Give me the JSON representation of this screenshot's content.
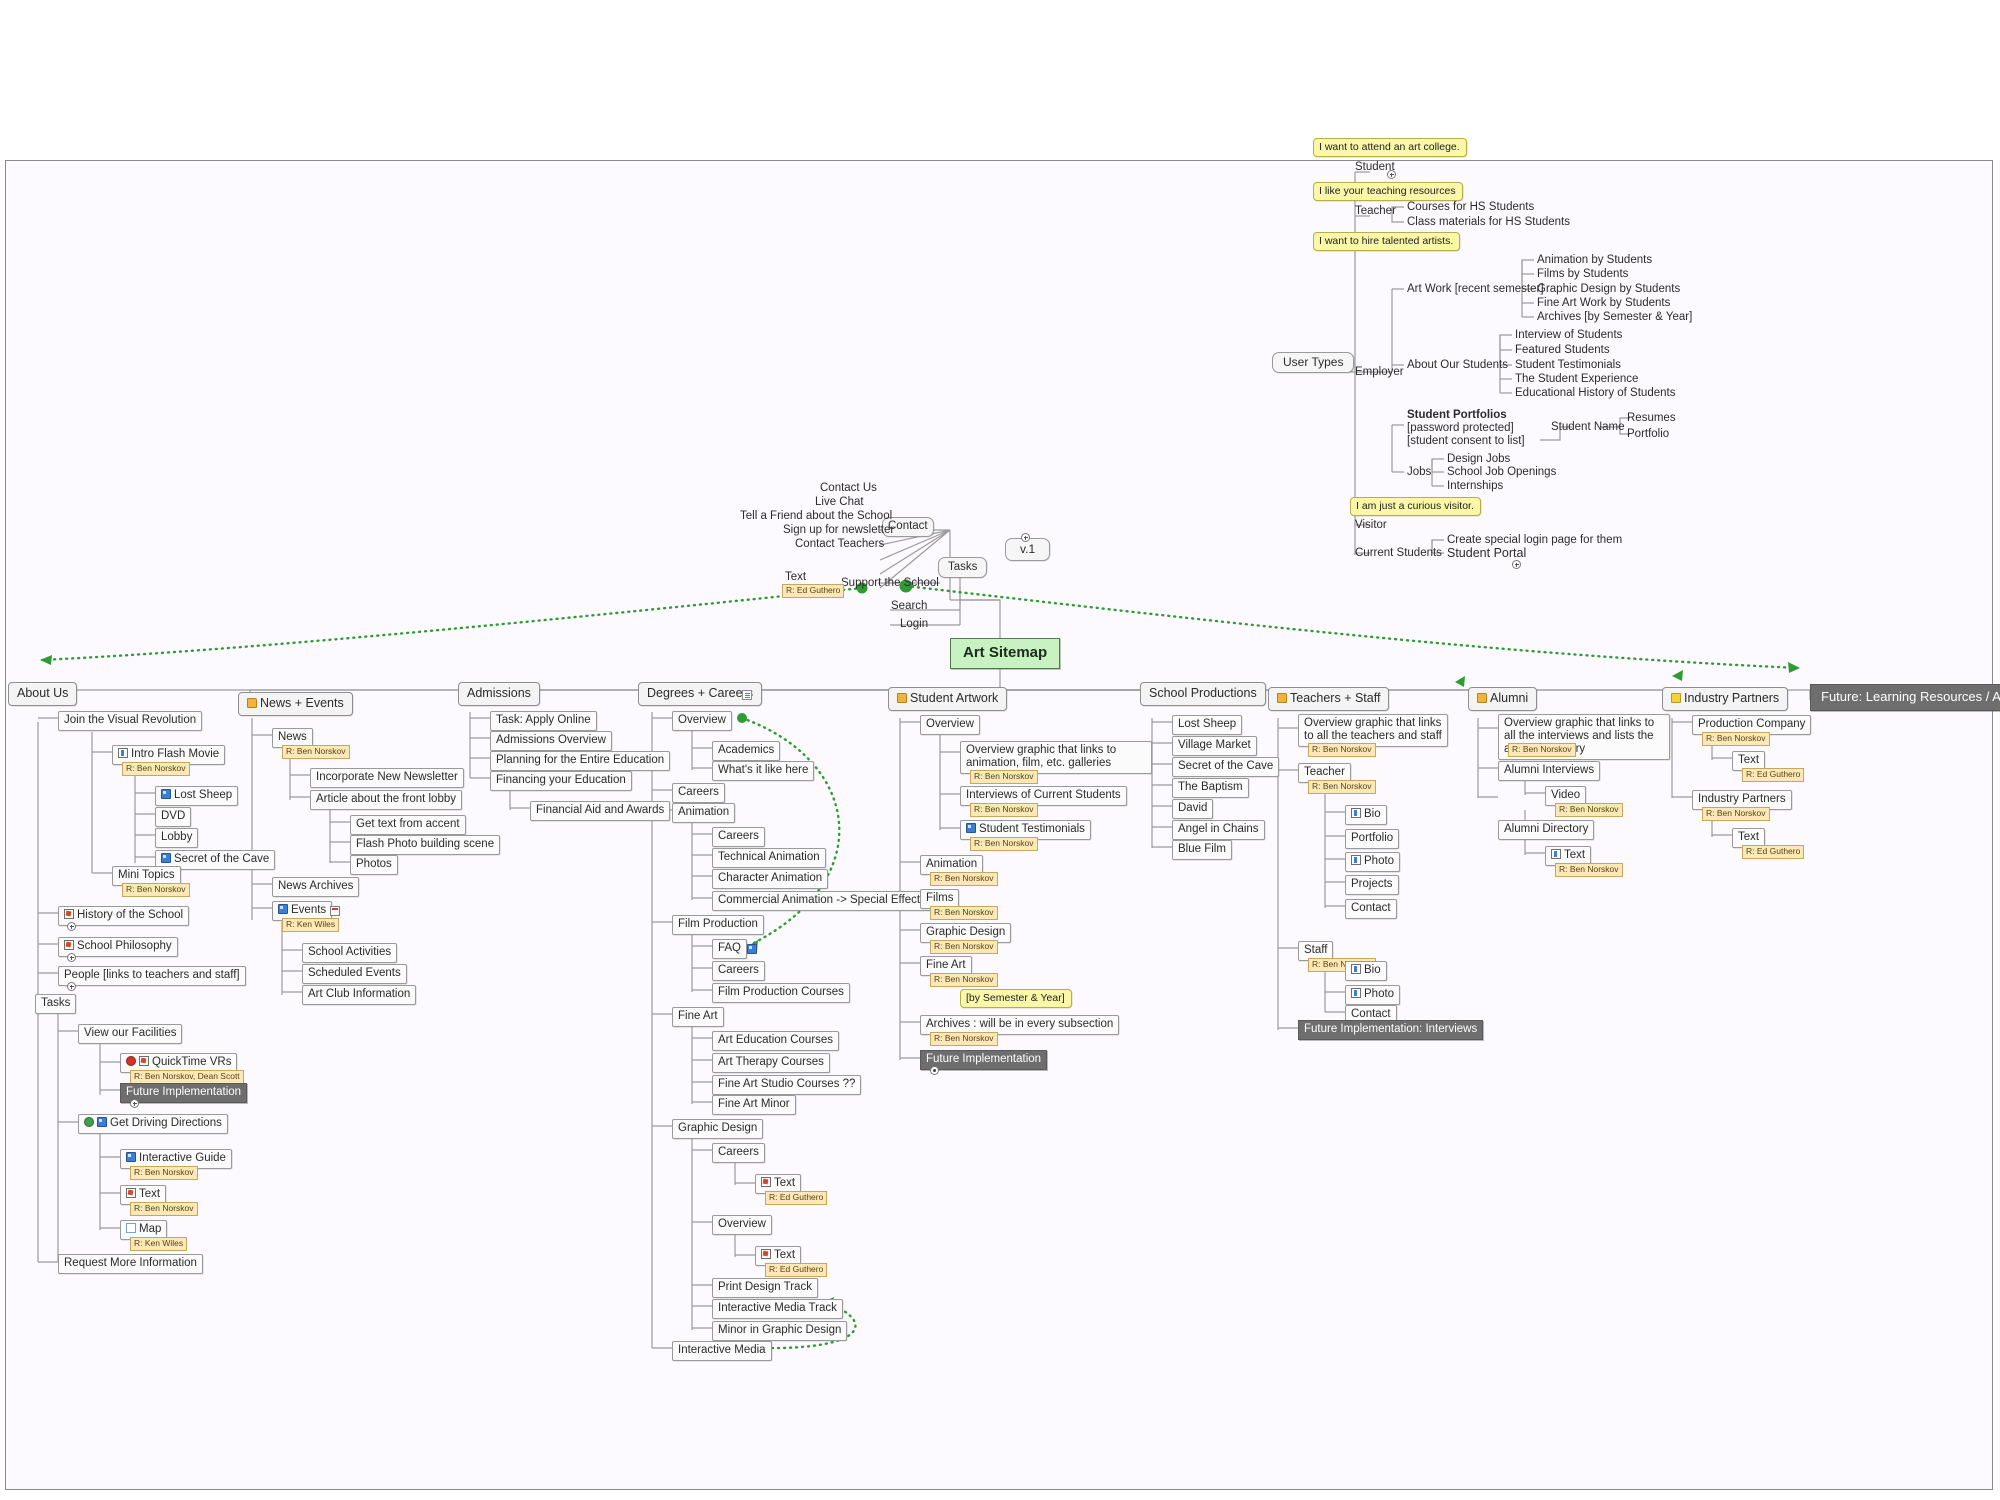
{
  "document": {
    "root_label": "Art Sitemap",
    "version_label": "v.1",
    "canvas_bg": "#fdfaff",
    "root_color": "#c9f2c2",
    "callout_color": "#fbf7a8",
    "chip_color": "#fbe8b8",
    "future_color": "#6e6e6e",
    "link_color": "#2e9b33"
  },
  "center": {
    "contact_label": "Contact",
    "tasks_label": "Tasks",
    "contact_children": [
      "Contact Us",
      "Live Chat",
      "Tell a Friend about the School",
      "Sign up for newsletter",
      "Contact Teachers"
    ],
    "tasks_children": [
      "Support the School",
      "Search",
      "Login"
    ],
    "text_node": "Text",
    "text_node_chip": "R: Ed Guthero"
  },
  "user_types": {
    "title": "User Types",
    "roles": [
      {
        "label": "Student",
        "callout": "I want to attend an art college.",
        "children": []
      },
      {
        "label": "Teacher",
        "callout": "I like your teaching resources",
        "children": [
          "Courses for HS Students",
          "Class materials for HS Students"
        ]
      },
      {
        "label": "Employer",
        "callout": "I want to hire talented artists.",
        "groups": [
          {
            "label": "Art Work [recent semester]",
            "children": [
              "Animation by Students",
              "Films by Students",
              "Graphic Design by Students",
              "Fine Art Work by Students",
              "Archives [by Semester & Year]"
            ]
          },
          {
            "label": "About Our Students",
            "children": [
              "Interview of Students",
              "Featured Students",
              "Student Testimonials",
              "The Student Experience",
              "Educational History of Students"
            ]
          },
          {
            "label_bold": "Student Portfolios",
            "label_rest": " [password protected] [student consent to list]",
            "children": [
              "Student Name"
            ],
            "grandchildren": [
              "Resumes",
              "Portfolio"
            ]
          },
          {
            "label": "Jobs",
            "children": [
              "Design Jobs",
              "School Job Openings",
              "Internships"
            ]
          }
        ]
      },
      {
        "label": "Visitor",
        "callout": "I am just a curious visitor.",
        "children": []
      },
      {
        "label": "Current Students",
        "children": [
          "Create special login page for them",
          "Student Portal"
        ]
      }
    ]
  },
  "branches": [
    {
      "title": "About Us",
      "icon": "none",
      "items": [
        {
          "label": "Join the Visual Revolution",
          "level": 1
        },
        {
          "label": "Intro Flash Movie",
          "level": 2,
          "icon": "bio-icon",
          "chip": "R: Ben Norskov"
        },
        {
          "label": "Lost Sheep",
          "level": 3,
          "icon": "blue-media-icon"
        },
        {
          "label": "DVD",
          "level": 3
        },
        {
          "label": "Lobby",
          "level": 3
        },
        {
          "label": "Secret of the Cave",
          "level": 3,
          "icon": "blue-media-icon"
        },
        {
          "label": "Mini Topics",
          "level": 2,
          "chip": "R: Ben Norskov"
        },
        {
          "label": "History of the School",
          "level": 1,
          "icon": "checklist-icon",
          "plus": true
        },
        {
          "label": "School Philosophy",
          "level": 1,
          "icon": "checklist-icon",
          "plus": true
        },
        {
          "label": "People [links to teachers and staff]",
          "level": 1,
          "plus": true
        },
        {
          "label": "Tasks",
          "level": 1
        },
        {
          "label": "View our Facilities",
          "level": 2
        },
        {
          "label": "QuickTime VRs",
          "level": 3,
          "icon": "red-dot-icon",
          "icon2": "checklist-icon",
          "chip": "R: Ben Norskov, Dean Scott"
        },
        {
          "label": "Future Implementation",
          "level": 3,
          "style": "future",
          "plus": true
        },
        {
          "label": "Get Driving Directions",
          "level": 2,
          "icon": "green-dot-icon",
          "icon2": "blue-media-icon"
        },
        {
          "label": "Interactive Guide",
          "level": 3,
          "icon": "blue-media-icon",
          "chip": "R: Ben Norskov"
        },
        {
          "label": "Text",
          "level": 3,
          "icon": "checklist-icon",
          "chip": "R: Ben Norskov"
        },
        {
          "label": "Map",
          "level": 3,
          "icon": "white-box-icon",
          "chip": "R: Ken Wiles"
        },
        {
          "label": "Request More Information",
          "level": 2
        }
      ]
    },
    {
      "title": "News + Events",
      "icon": "folder-icon",
      "items": [
        {
          "label": "News",
          "level": 1,
          "chip": "R: Ben Norskov"
        },
        {
          "label": "Incorporate New Newsletter",
          "level": 2
        },
        {
          "label": "Article about the front lobby",
          "level": 2
        },
        {
          "label": "Get text from accent",
          "level": 3
        },
        {
          "label": "Flash Photo building scene",
          "level": 3
        },
        {
          "label": "Photos",
          "level": 3
        },
        {
          "label": "News Archives",
          "level": 1
        },
        {
          "label": "Events",
          "level": 1,
          "icon": "blue-media-icon",
          "icon_after": "note-icon",
          "chip": "R: Ken Wiles"
        },
        {
          "label": "School Activities",
          "level": 2
        },
        {
          "label": "Scheduled Events",
          "level": 2
        },
        {
          "label": "Art Club Information",
          "level": 2
        }
      ]
    },
    {
      "title": "Admissions",
      "icon": "none",
      "items": [
        {
          "label": "Task: Apply Online",
          "level": 1
        },
        {
          "label": "Admissions Overview",
          "level": 1
        },
        {
          "label": "Planning for the Entire Education",
          "level": 1
        },
        {
          "label": "Financing your Education",
          "level": 1
        },
        {
          "label": "Financial Aid and Awards",
          "level": 2
        }
      ]
    },
    {
      "title": "Degrees + Careers",
      "icon": "none",
      "icon_after": "doc-icon",
      "items": [
        {
          "label": "Overview",
          "level": 1
        },
        {
          "label": "Academics",
          "level": 2
        },
        {
          "label": "What's it like here",
          "level": 2
        },
        {
          "label": "Careers",
          "level": 1
        },
        {
          "label": "Animation",
          "level": 1
        },
        {
          "label": "Careers",
          "level": 2
        },
        {
          "label": "Technical Animation",
          "level": 2
        },
        {
          "label": "Character Animation",
          "level": 2
        },
        {
          "label": "Commercial Animation -> Special Effects",
          "level": 2
        },
        {
          "label": "Film Production",
          "level": 1
        },
        {
          "label": "FAQ",
          "level": 2,
          "icon_after": "blue-media-icon"
        },
        {
          "label": "Careers",
          "level": 2
        },
        {
          "label": "Film Production Courses",
          "level": 2
        },
        {
          "label": "Fine Art",
          "level": 1
        },
        {
          "label": "Art Education Courses",
          "level": 2
        },
        {
          "label": "Art Therapy Courses",
          "level": 2
        },
        {
          "label": "Fine Art Studio Courses ??",
          "level": 2
        },
        {
          "label": "Fine Art Minor",
          "level": 2
        },
        {
          "label": "Graphic Design",
          "level": 1
        },
        {
          "label": "Careers",
          "level": 2
        },
        {
          "label": "Text",
          "level": 3,
          "icon": "checklist-icon",
          "chip": "R: Ed Guthero"
        },
        {
          "label": "Overview",
          "level": 2
        },
        {
          "label": "Text",
          "level": 3,
          "icon": "checklist-icon",
          "chip": "R: Ed Guthero"
        },
        {
          "label": "Print Design Track",
          "level": 2
        },
        {
          "label": "Interactive Media Track",
          "level": 2
        },
        {
          "label": "Minor in Graphic Design",
          "level": 2
        },
        {
          "label": "Interactive Media",
          "level": 1
        }
      ]
    },
    {
      "title": "Student Artwork",
      "icon": "folder-icon",
      "items": [
        {
          "label": "Overview",
          "level": 1
        },
        {
          "label": "Overview graphic that links to animation, film, etc. galleries",
          "level": 2,
          "wrap": true,
          "chip": "R: Ben Norskov"
        },
        {
          "label": "Interviews of Current Students",
          "level": 2,
          "chip": "R: Ben Norskov"
        },
        {
          "label": "Student Testimonials",
          "level": 2,
          "icon": "blue-media-icon",
          "chip": "R: Ben Norskov"
        },
        {
          "label": "Animation",
          "level": 1,
          "chip": "R: Ben Norskov"
        },
        {
          "label": "Films",
          "level": 1,
          "chip": "R: Ben Norskov"
        },
        {
          "label": "Graphic Design",
          "level": 1,
          "chip": "R: Ben Norskov"
        },
        {
          "label": "Fine Art",
          "level": 1,
          "chip": "R: Ben Norskov"
        },
        {
          "label": "Archives : will be in every subsection",
          "level": 1,
          "chip": "R: Ben Norskov",
          "callout": "[by Semester & Year]"
        },
        {
          "label": "Future Implementation",
          "level": 1,
          "style": "future",
          "plus": true
        }
      ]
    },
    {
      "title": "School Productions",
      "icon": "none",
      "items": [
        {
          "label": "Lost Sheep",
          "level": 1
        },
        {
          "label": "Village Market",
          "level": 1
        },
        {
          "label": "Secret of the Cave",
          "level": 1
        },
        {
          "label": "The Baptism",
          "level": 1
        },
        {
          "label": "David",
          "level": 1
        },
        {
          "label": "Angel in Chains",
          "level": 1
        },
        {
          "label": "Blue Film",
          "level": 1
        }
      ]
    },
    {
      "title": "Teachers + Staff",
      "icon": "folder-icon",
      "items": [
        {
          "label": "Overview graphic that links to all the teachers and staff",
          "level": 1,
          "wrap": true,
          "chip": "R: Ben Norskov"
        },
        {
          "label": "Teacher",
          "level": 1,
          "chip": "R: Ben Norskov"
        },
        {
          "label": "Bio",
          "level": 2,
          "icon": "bio-icon"
        },
        {
          "label": "Portfolio",
          "level": 2
        },
        {
          "label": "Photo",
          "level": 2,
          "icon": "bio-icon"
        },
        {
          "label": "Projects",
          "level": 2
        },
        {
          "label": "Contact",
          "level": 2
        },
        {
          "label": "Staff",
          "level": 1,
          "chip": "R: Ben Norskov"
        },
        {
          "label": "Bio",
          "level": 2,
          "icon": "bio-icon"
        },
        {
          "label": "Photo",
          "level": 2,
          "icon": "bio-icon"
        },
        {
          "label": "Contact",
          "level": 2
        },
        {
          "label": "Future Implementation: Interviews",
          "level": 1,
          "style": "future"
        }
      ]
    },
    {
      "title": "Alumni",
      "icon": "folder-icon",
      "items": [
        {
          "label": "Overview graphic that links to all the interviews and lists the alumni directory",
          "level": 1,
          "wrap": true,
          "chip": "R: Ben Norskov"
        },
        {
          "label": "Alumni Interviews",
          "level": 1
        },
        {
          "label": "Video",
          "level": 2,
          "chip": "R: Ben Norskov"
        },
        {
          "label": "Alumni Directory",
          "level": 1
        },
        {
          "label": "Text",
          "level": 2,
          "icon": "bio-icon",
          "chip": "R: Ben Norskov"
        }
      ]
    },
    {
      "title": "Industry Partners",
      "icon": "yellow-icon",
      "items": [
        {
          "label": "Production Company",
          "level": 1,
          "chip": "R: Ben Norskov"
        },
        {
          "label": "Text",
          "level": 2,
          "chip": "R: Ed Guthero"
        },
        {
          "label": "Industry Partners",
          "level": 1,
          "chip": "R: Ben Norskov"
        },
        {
          "label": "Text",
          "level": 2,
          "chip": "R: Ed Guthero"
        }
      ]
    }
  ],
  "future_node": {
    "label": "Future: Learning Resources / Art Forum"
  }
}
